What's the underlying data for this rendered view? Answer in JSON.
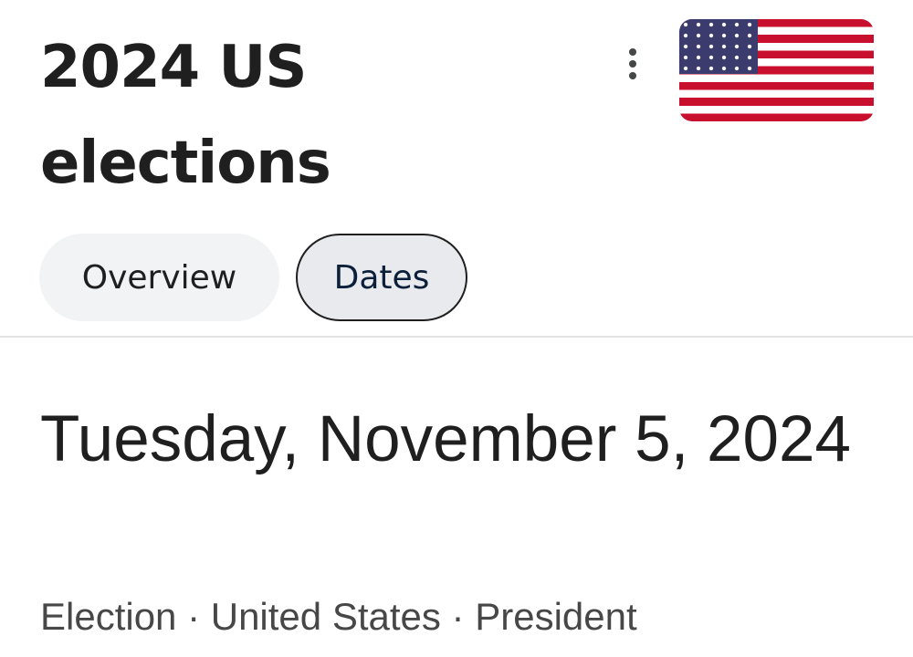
{
  "header": {
    "title": "2024 US elections",
    "more_icon": "more-vert-icon",
    "flag_image": "us-flag-icon",
    "flag_colors": {
      "red": "#c8102e",
      "white": "#ffffff",
      "blue": "#3c3b6e"
    }
  },
  "tabs": [
    {
      "label": "Overview",
      "selected": false
    },
    {
      "label": "Dates",
      "selected": true
    }
  ],
  "event": {
    "date": "Tuesday, November 5, 2024",
    "details": "Election · United States · President"
  }
}
